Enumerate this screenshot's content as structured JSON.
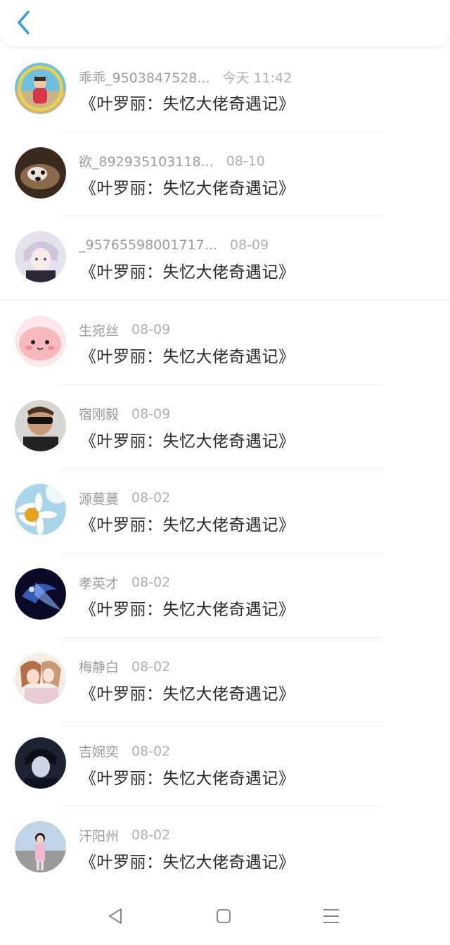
{
  "colors": {
    "accent": "#2f9cf1",
    "name_text": "#9d9d9d",
    "title_text": "#2c2c2c",
    "divider": "#eeeeee"
  },
  "header": {
    "back_icon": "chevron-left-icon"
  },
  "items": [
    {
      "name": "乖乖_9503847528...",
      "time": "今天 11:42",
      "title": "《叶罗丽：失忆大佬奇遇记》"
    },
    {
      "name": "欲_892935103118...",
      "time": "08-10",
      "title": "《叶罗丽：失忆大佬奇遇记》"
    },
    {
      "name": "_95765598001717...",
      "time": "08-09",
      "title": "《叶罗丽：失忆大佬奇遇记》"
    },
    {
      "name": "生宛丝",
      "time": "08-09",
      "title": "《叶罗丽：失忆大佬奇遇记》"
    },
    {
      "name": "宿刚毅",
      "time": "08-09",
      "title": "《叶罗丽：失忆大佬奇遇记》"
    },
    {
      "name": "源蔓蔓",
      "time": "08-02",
      "title": "《叶罗丽：失忆大佬奇遇记》"
    },
    {
      "name": "孝英才",
      "time": "08-02",
      "title": "《叶罗丽：失忆大佬奇遇记》"
    },
    {
      "name": "梅静白",
      "time": "08-02",
      "title": "《叶罗丽：失忆大佬奇遇记》"
    },
    {
      "name": "吉婉奕",
      "time": "08-02",
      "title": "《叶罗丽：失忆大佬奇遇记》"
    },
    {
      "name": "汗阳州",
      "time": "08-02",
      "title": "《叶罗丽：失忆大佬奇遇记》"
    }
  ],
  "navbar": {
    "back_icon": "triangle-back-icon",
    "home_icon": "square-home-icon",
    "menu_icon": "menu-lines-icon"
  }
}
